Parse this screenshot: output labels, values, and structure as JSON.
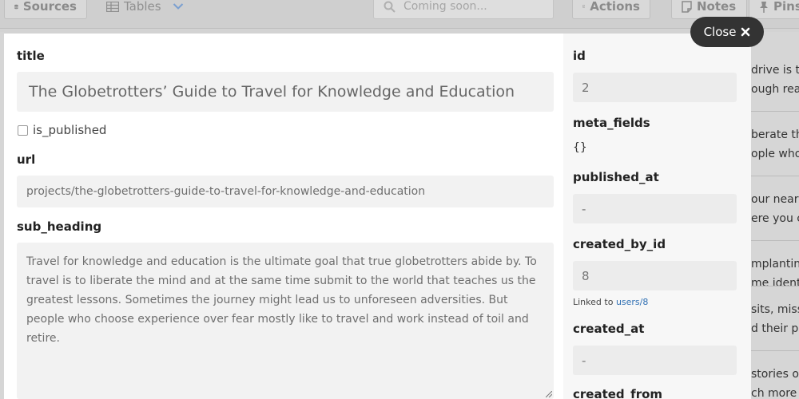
{
  "toolbar": {
    "sources_label": "Sources",
    "tables_label": "Tables",
    "search_placeholder": "Coming soon...",
    "actions_label": "Actions",
    "notes_label": "Notes",
    "pins_label": "Pins"
  },
  "background_rows": [
    "drive is th",
    "ough real",
    "berate the",
    "ople who",
    "our near a",
    "ere you ca",
    "mplantin",
    "me identi",
    "sits, miss",
    "d their pa",
    "stories of",
    "ch more"
  ],
  "modal": {
    "close_label": "Close",
    "title": {
      "label": "title",
      "value": "The Globetrotters’ Guide to Travel for Knowledge and Education"
    },
    "is_published": {
      "label": "is_published",
      "checked": false
    },
    "url": {
      "label": "url",
      "value": "projects/the-globetrotters-guide-to-travel-for-knowledge-and-education"
    },
    "sub_heading": {
      "label": "sub_heading",
      "value": "Travel for knowledge and education is the ultimate goal that true globetrotters abide by. To travel is to liberate the mind and at the same time submit to the world that teaches us the greatest lessons. Sometimes the journey might lead us to unforeseen adversities. But people who choose experience over fear mostly like to travel and work instead of toil and retire."
    },
    "side": {
      "id": {
        "label": "id",
        "value": "2"
      },
      "meta_fields": {
        "label": "meta_fields",
        "value": "{}"
      },
      "published_at": {
        "label": "published_at",
        "value": "-"
      },
      "created_by_id": {
        "label": "created_by_id",
        "value": "8",
        "link_prefix": "Linked to",
        "link_text": "users/8"
      },
      "created_at": {
        "label": "created_at",
        "value": "-"
      },
      "created_from": {
        "label": "created_from"
      }
    }
  },
  "colors": {
    "link": "#2f6fb3",
    "close_bg": "#333333",
    "backdrop": "#d3d3d3"
  }
}
